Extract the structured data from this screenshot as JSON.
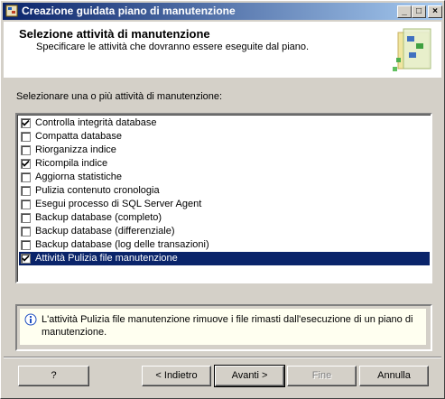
{
  "window": {
    "title": "Creazione guidata piano di manutenzione",
    "minimize": "_",
    "maximize": "□",
    "close": "×"
  },
  "header": {
    "title": "Selezione attività di manutenzione",
    "subtitle": "Specificare le attività che dovranno essere eseguite dal piano."
  },
  "list": {
    "label": "Selezionare una o più attività di manutenzione:",
    "items": [
      {
        "label": "Controlla integrità database",
        "checked": true
      },
      {
        "label": "Compatta database",
        "checked": false
      },
      {
        "label": "Riorganizza indice",
        "checked": false
      },
      {
        "label": "Ricompila indice",
        "checked": true
      },
      {
        "label": "Aggiorna statistiche",
        "checked": false
      },
      {
        "label": "Pulizia contenuto cronologia",
        "checked": false
      },
      {
        "label": "Esegui processo di SQL Server Agent",
        "checked": false
      },
      {
        "label": "Backup database (completo)",
        "checked": false
      },
      {
        "label": "Backup database (differenziale)",
        "checked": false
      },
      {
        "label": "Backup database (log delle transazioni)",
        "checked": false
      },
      {
        "label": "Attività Pulizia file manutenzione",
        "checked": true,
        "selected": true
      }
    ]
  },
  "info": {
    "icon": "info-icon",
    "text": "L'attività Pulizia file manutenzione rimuove i file rimasti dall'esecuzione di un piano di manutenzione."
  },
  "buttons": {
    "help": "?",
    "back": "< Indietro",
    "next": "Avanti >",
    "finish": "Fine",
    "cancel": "Annulla"
  },
  "colors": {
    "title_start": "#0a246a",
    "title_end": "#a6caf0",
    "selection": "#0a246a",
    "face": "#d4d0c8"
  }
}
